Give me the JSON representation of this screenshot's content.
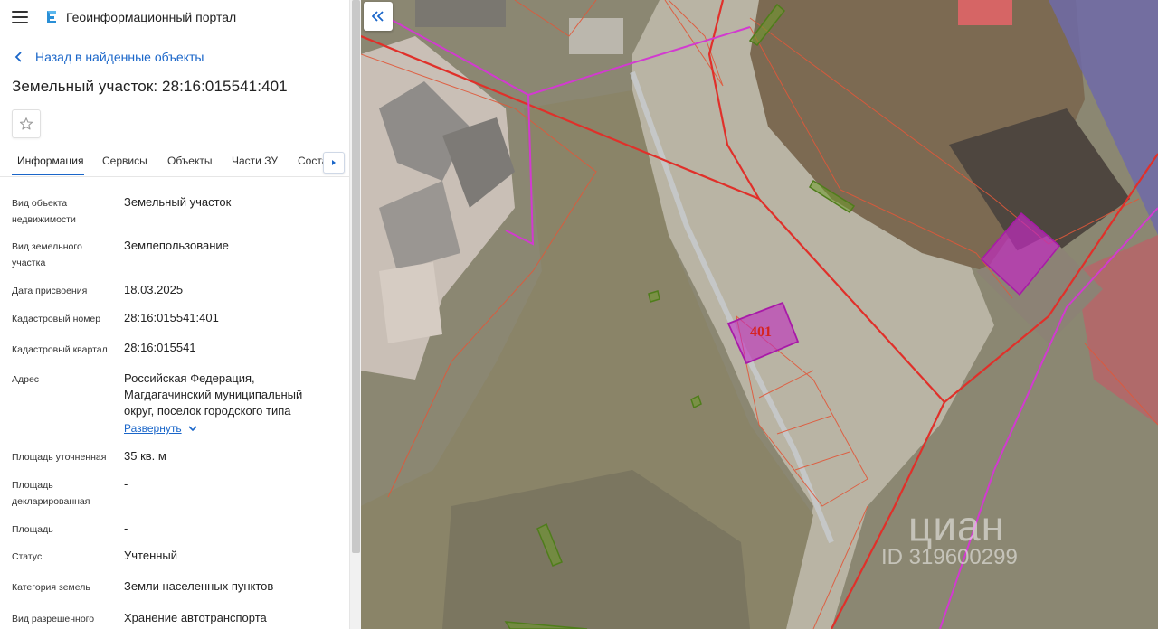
{
  "header": {
    "app_title": "Геоинформационный портал"
  },
  "back_link": "Назад в найденные объекты",
  "page_title": "Земельный участок: 28:16:015541:401",
  "tabs": [
    {
      "label": "Информация",
      "active": true
    },
    {
      "label": "Сервисы"
    },
    {
      "label": "Объекты"
    },
    {
      "label": "Части ЗУ"
    },
    {
      "label": "Состав"
    }
  ],
  "fields": [
    {
      "label": "Вид объекта недвижимости",
      "value": "Земельный участок"
    },
    {
      "label": "Вид земельного участка",
      "value": "Землепользование"
    },
    {
      "label": "Дата присвоения",
      "value": "18.03.2025"
    },
    {
      "label": "Кадастровый номер",
      "value": "28:16:015541:401"
    },
    {
      "label": "Кадастровый квартал",
      "value": "28:16:015541"
    },
    {
      "label": "Адрес",
      "value": "Российская Федерация, Магдагачинский муниципальный округ, поселок городского типа"
    },
    {
      "label": "Площадь уточненная",
      "value": "35 кв. м"
    },
    {
      "label": "Площадь декларированная",
      "value": "-"
    },
    {
      "label": "Площадь",
      "value": "-"
    },
    {
      "label": "Статус",
      "value": "Учтенный"
    },
    {
      "label": "Категория земель",
      "value": "Земли населенных пунктов"
    },
    {
      "label": "Вид разрешенного",
      "value": "Хранение автотранспорта"
    }
  ],
  "expand_label": "Развернуть",
  "map": {
    "parcel_label": "401",
    "watermark_brand": "циан",
    "watermark_id": "ID 319600299"
  },
  "colors": {
    "accent": "#1a66c9",
    "parcel_fill": "#c02bbf",
    "boundary_red": "#e0302a",
    "boundary_magenta": "#d23ad0"
  },
  "icons": {
    "menu": "hamburger-icon",
    "logo": "portal-logo-icon",
    "back": "chevron-left-icon",
    "favorite": "star-icon",
    "tabs_next": "triangle-right-icon",
    "expand": "chevron-down-icon",
    "collapse_panel": "double-chevron-left-icon"
  }
}
